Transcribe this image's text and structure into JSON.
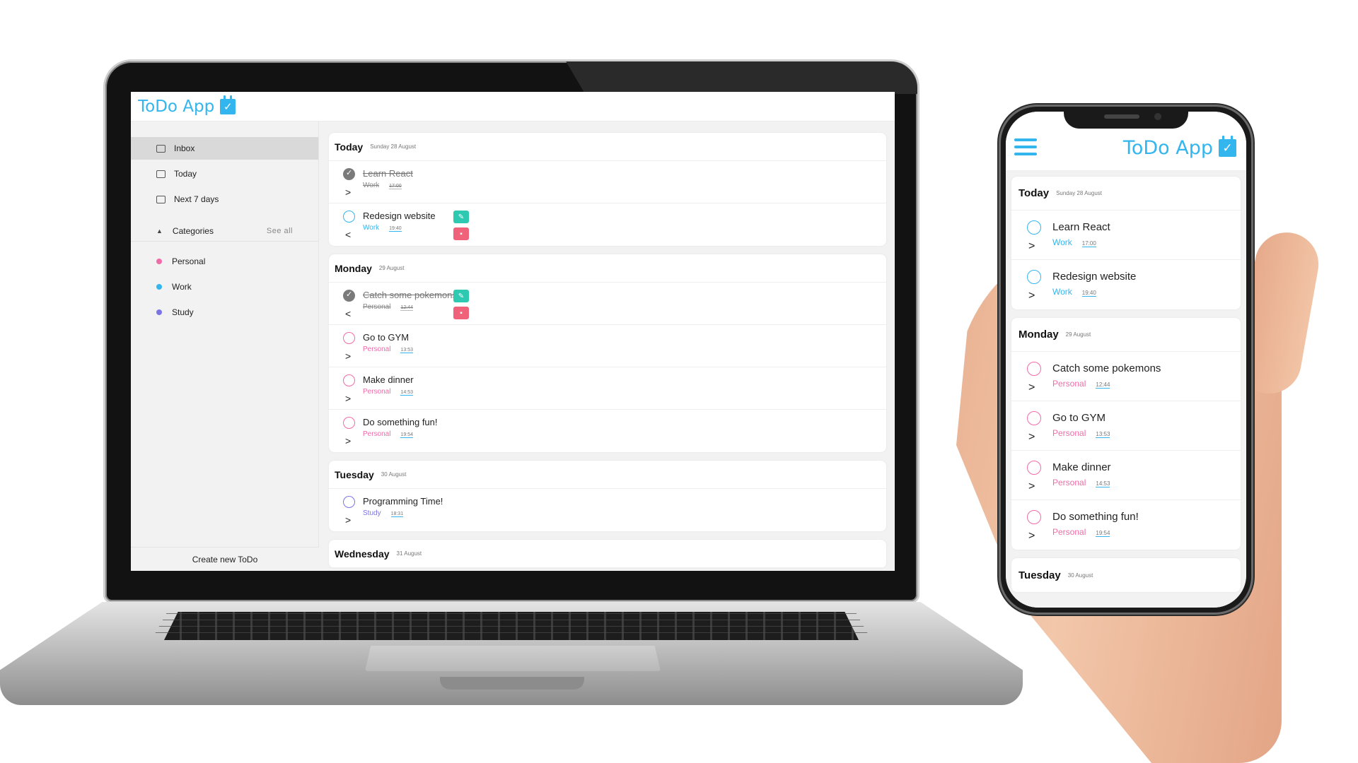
{
  "colors": {
    "accent": "#33b5ee",
    "personal": "#f06ba8",
    "work": "#33b5ee",
    "study": "#7b74e4",
    "edit": "#2dc9b1",
    "delete": "#f0617a",
    "done": "#7a7a7a"
  },
  "app": {
    "title": "ToDo App",
    "logo_icon": "calendar-check-icon"
  },
  "sidebar": {
    "nav": [
      {
        "label": "Inbox",
        "icon": "inbox-icon"
      },
      {
        "label": "Today",
        "icon": "calendar-icon"
      },
      {
        "label": "Next 7 days",
        "icon": "calendar-week-icon"
      }
    ],
    "categories_label": "Categories",
    "see_all": "See all",
    "categories": [
      {
        "label": "Personal",
        "color": "#f06ba8"
      },
      {
        "label": "Work",
        "color": "#33b5ee"
      },
      {
        "label": "Study",
        "color": "#7b74e4"
      }
    ],
    "create_label": "Create new ToDo"
  },
  "desktop_days": [
    {
      "name": "Today",
      "date": "Sunday 28 August",
      "tasks": [
        {
          "title": "Learn React",
          "category": "Work",
          "time": "17:00",
          "done": true,
          "expanded": false
        },
        {
          "title": "Redesign website",
          "category": "Work",
          "time": "19:40",
          "done": false,
          "expanded": true
        }
      ]
    },
    {
      "name": "Monday",
      "date": "29 August",
      "tasks": [
        {
          "title": "Catch some pokemons",
          "category": "Personal",
          "time": "12:44",
          "done": true,
          "expanded": true
        },
        {
          "title": "Go to GYM",
          "category": "Personal",
          "time": "13:53",
          "done": false,
          "expanded": false
        },
        {
          "title": "Make dinner",
          "category": "Personal",
          "time": "14:53",
          "done": false,
          "expanded": false
        },
        {
          "title": "Do something fun!",
          "category": "Personal",
          "time": "19:54",
          "done": false,
          "expanded": false
        }
      ]
    },
    {
      "name": "Tuesday",
      "date": "30 August",
      "tasks": [
        {
          "title": "Programming Time!",
          "category": "Study",
          "time": "18:31",
          "done": false,
          "expanded": false
        }
      ]
    },
    {
      "name": "Wednesday",
      "date": "31 August",
      "tasks": []
    }
  ],
  "mobile_days": [
    {
      "name": "Today",
      "date": "Sunday 28 August",
      "tasks": [
        {
          "title": "Learn React",
          "category": "Work",
          "time": "17:00"
        },
        {
          "title": "Redesign website",
          "category": "Work",
          "time": "19:40"
        }
      ]
    },
    {
      "name": "Monday",
      "date": "29 August",
      "tasks": [
        {
          "title": "Catch some pokemons",
          "category": "Personal",
          "time": "12:44"
        },
        {
          "title": "Go to GYM",
          "category": "Personal",
          "time": "13:53"
        },
        {
          "title": "Make dinner",
          "category": "Personal",
          "time": "14:53"
        },
        {
          "title": "Do something fun!",
          "category": "Personal",
          "time": "19:54"
        }
      ]
    },
    {
      "name": "Tuesday",
      "date": "30 August",
      "tasks": []
    }
  ]
}
